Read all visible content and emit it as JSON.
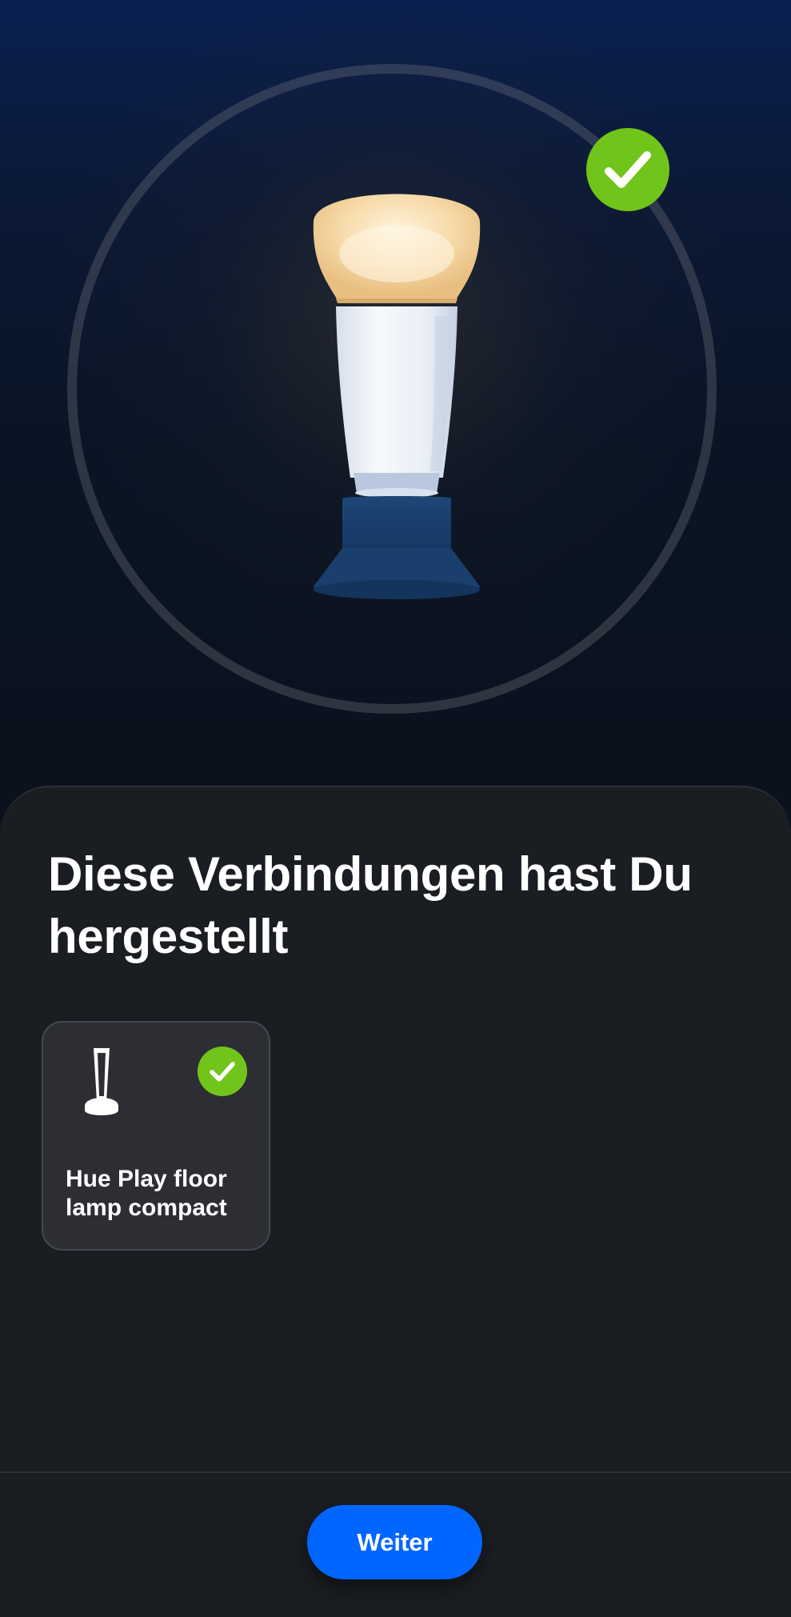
{
  "hero": {
    "illustration_icon": "light-bulb-on-base-icon",
    "status_icon": "checkmark-icon",
    "status_color": "#71c41a"
  },
  "sheet": {
    "title": "Diese Verbindungen hast Du hergestellt"
  },
  "connections": [
    {
      "name": "Hue Play floor lamp compact",
      "icon": "floor-lamp-icon",
      "status_icon": "checkmark-icon",
      "connected": true
    }
  ],
  "footer": {
    "next_label": "Weiter",
    "button_color": "#0066ff"
  },
  "colors": {
    "background": "#181b20",
    "card": "#2c2e33",
    "accent_green": "#71c41a",
    "primary_blue": "#0066ff"
  }
}
